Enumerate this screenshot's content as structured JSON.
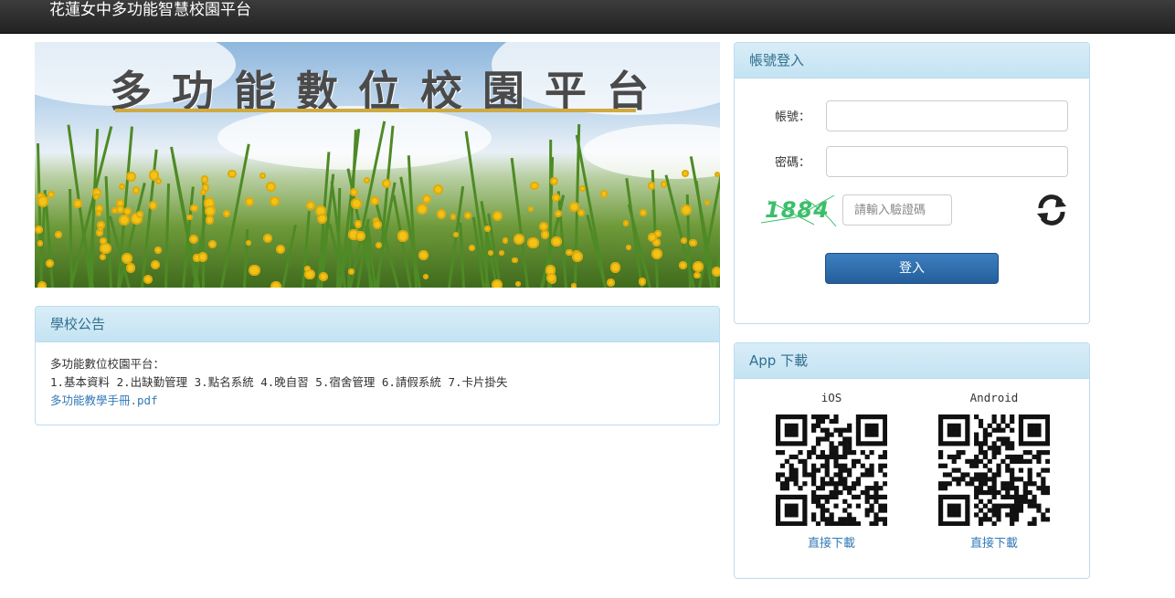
{
  "navbar": {
    "brand": "花蓮女中多功能智慧校園平台"
  },
  "banner": {
    "title": "多功能數位校園平台"
  },
  "notice": {
    "heading": "學校公告",
    "line1": "多功能數位校園平台：",
    "line2": "1.基本資料 2.出缺勤管理 3.點名系統 4.晚自習 5.宿舍管理 6.請假系統 7.卡片掛失",
    "link": "多功能教學手冊.pdf"
  },
  "login": {
    "heading": "帳號登入",
    "account_label": "帳號：",
    "password_label": "密碼：",
    "captcha_text": "1884",
    "captcha_placeholder": "請輸入驗證碼",
    "submit_label": "登入"
  },
  "app": {
    "heading": "App 下載",
    "ios_label": "iOS",
    "android_label": "Android",
    "ios_link": "直接下載",
    "android_link": "直接下載"
  },
  "colors": {
    "navbar": "#222222",
    "panel_heading": "#d9edf7",
    "panel_heading_text": "#31708f",
    "link": "#337ab7",
    "login_button": "#2c6aa8"
  }
}
